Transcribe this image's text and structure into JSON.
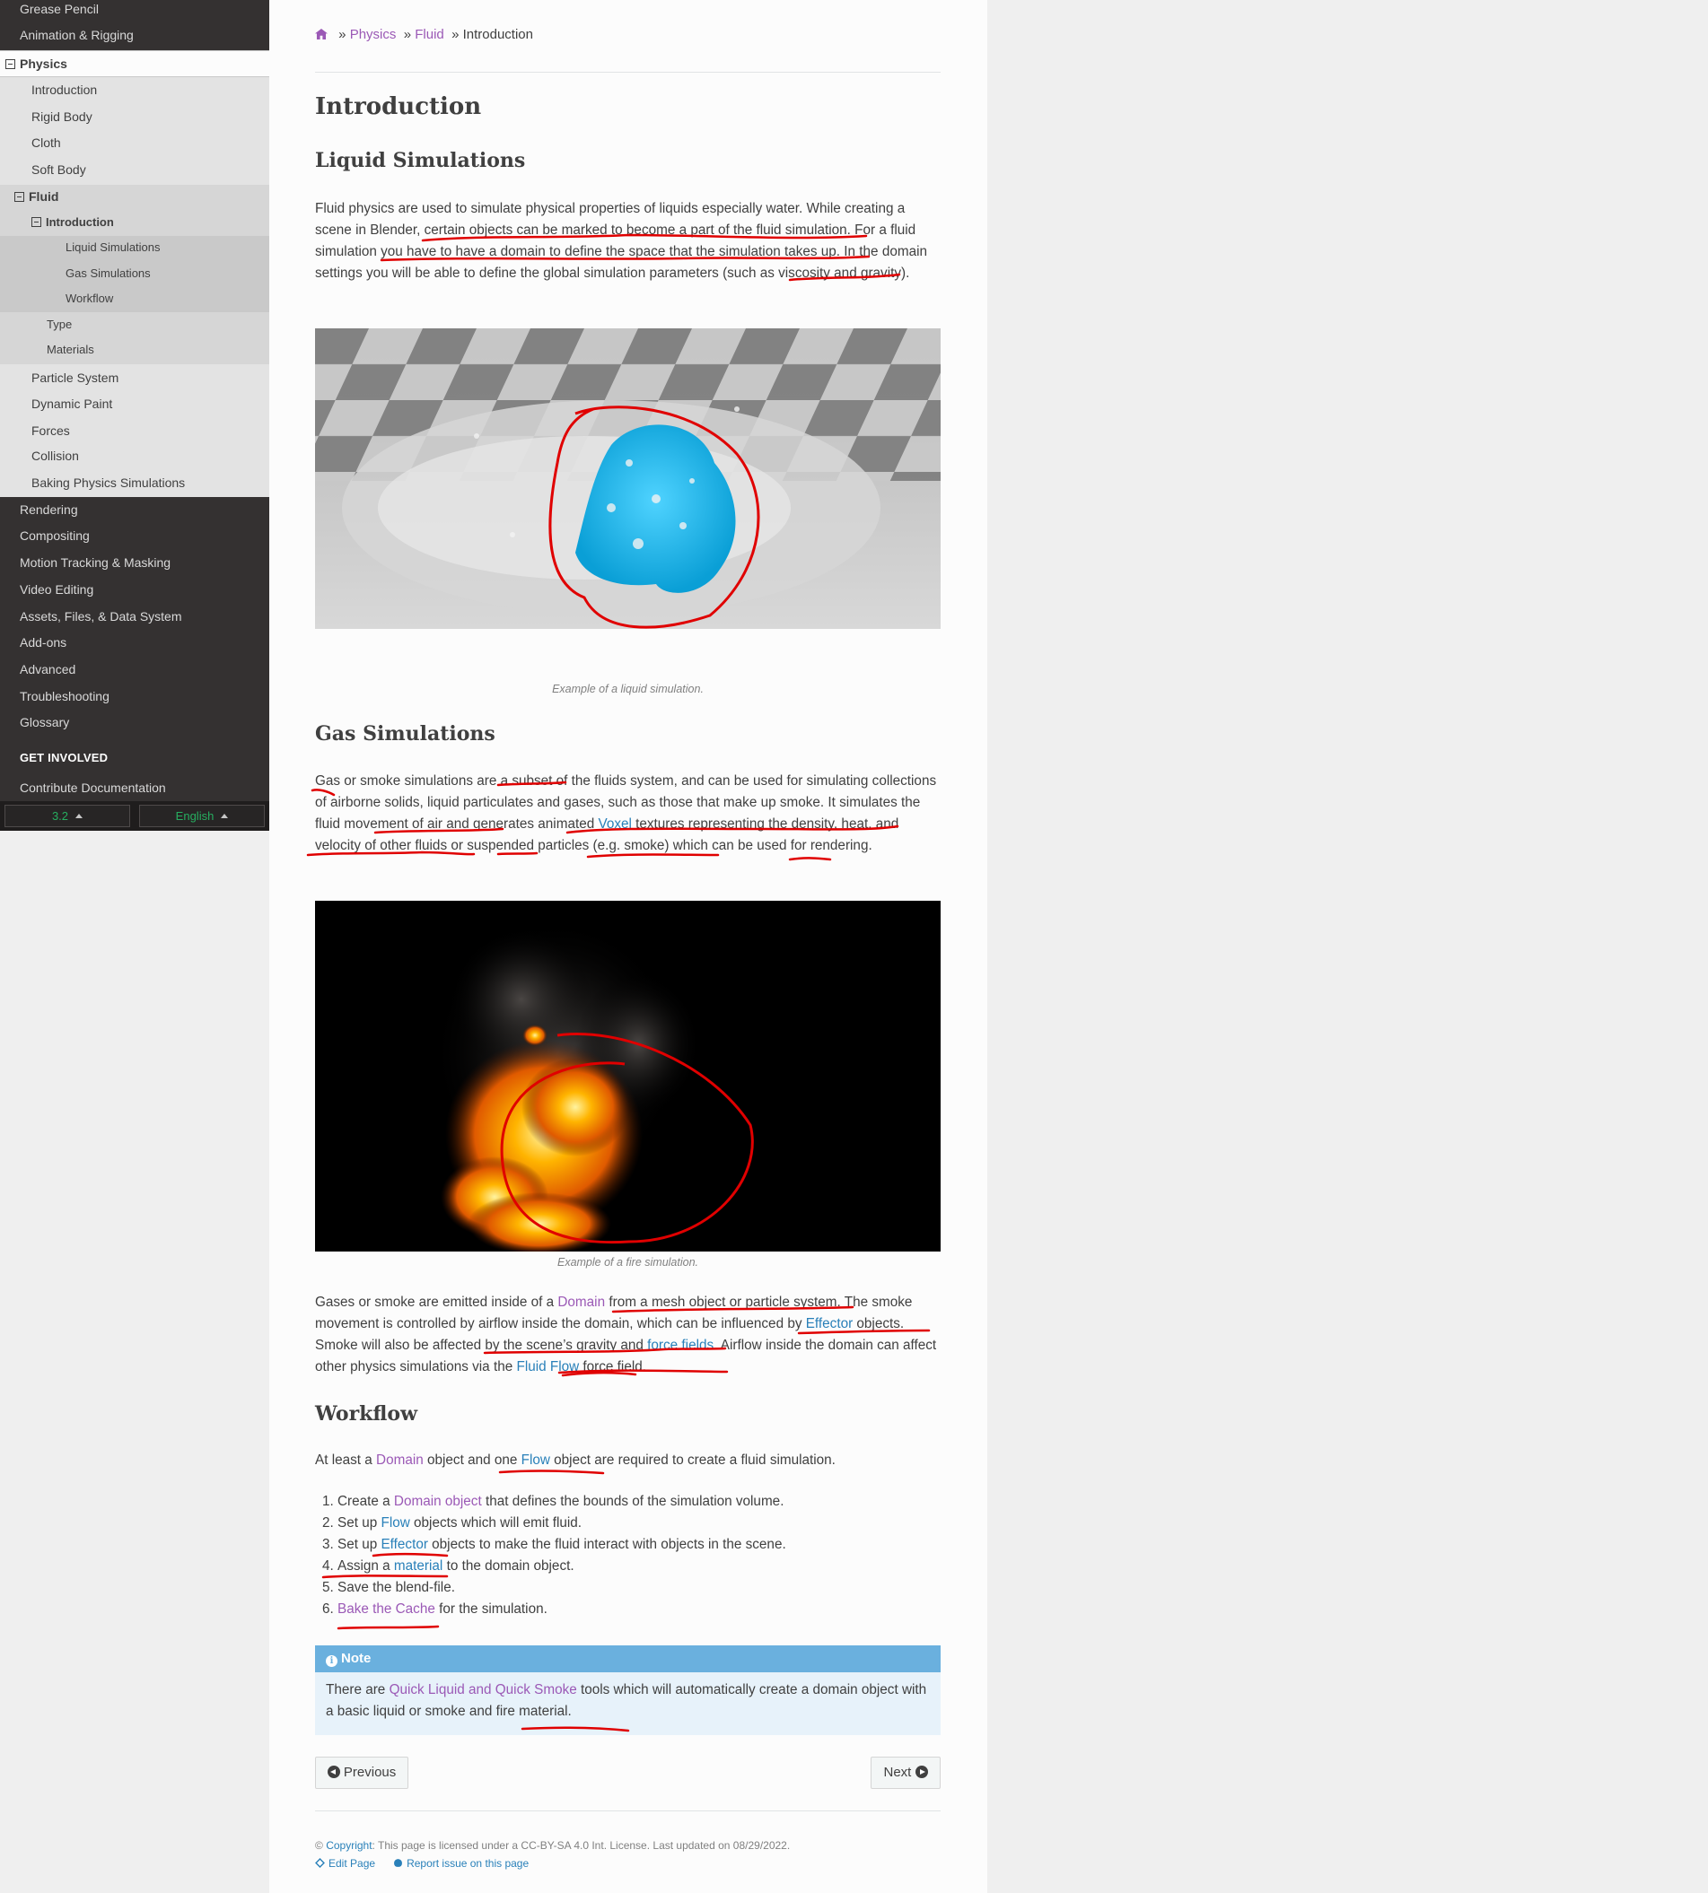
{
  "sidebar": {
    "top_items": [
      "Grease Pencil",
      "Animation & Rigging"
    ],
    "physics_label": "Physics",
    "physics_children": [
      "Introduction",
      "Rigid Body",
      "Cloth",
      "Soft Body"
    ],
    "fluid_label": "Fluid",
    "intro_label": "Introduction",
    "intro_children": [
      "Liquid Simulations",
      "Gas Simulations",
      "Workflow"
    ],
    "fluid_children": [
      "Type",
      "Materials"
    ],
    "physics_more": [
      "Particle System",
      "Dynamic Paint",
      "Forces",
      "Collision",
      "Baking Physics Simulations"
    ],
    "other_sections": [
      "Rendering",
      "Compositing",
      "Motion Tracking & Masking",
      "Video Editing",
      "Assets, Files, & Data System",
      "Add-ons",
      "Advanced",
      "Troubleshooting",
      "Glossary"
    ],
    "caption": "GET INVOLVED",
    "contribute": "Contribute Documentation",
    "version": "3.2",
    "language": "English",
    "colors": {
      "version": "#27ae60",
      "language": "#27ae60",
      "background": "#343131"
    }
  },
  "breadcrumb": {
    "physics": "Physics",
    "fluid": "Fluid",
    "current": "Introduction",
    "sep": "»"
  },
  "title": "Introduction",
  "liquid": {
    "heading": "Liquid Simulations",
    "para": "Fluid physics are used to simulate physical properties of liquids especially water. While creating a scene in Blender, certain objects can be marked to become a part of the fluid simulation. For a fluid simulation you have to have a domain to define the space that the simulation takes up. In the domain settings you will be able to define the global simulation parameters (such as viscosity and gravity).",
    "caption": "Example of a liquid simulation."
  },
  "gas": {
    "heading": "Gas Simulations",
    "para_pre": "Gas or smoke simulations are a subset of the fluids system, and can be used for simulating collections of airborne solids, liquid particulates and gases, such as those that make up smoke. It simulates the fluid movement of air and generates animated ",
    "voxel": "Voxel",
    "para_post": " textures representing the density, heat, and velocity of other fluids or suspended particles (e.g. smoke) which can be used for rendering.",
    "caption": "Example of a fire simulation.",
    "p2_a": "Gases or smoke are emitted inside of a ",
    "p2_domain": "Domain",
    "p2_b": " from a mesh object or particle system. The smoke movement is controlled by airflow inside the domain, which can be influenced by ",
    "p2_effector": "Effector",
    "p2_c": " objects. Smoke will also be affected by the scene’s gravity and ",
    "p2_forcefields": "force fields",
    "p2_d": ". Airflow inside the domain can affect other physics simulations via the ",
    "p2_fluidflow": "Fluid Flow",
    "p2_e": " force field."
  },
  "workflow": {
    "heading": "Workflow",
    "intro_a": "At least a ",
    "intro_domain": "Domain",
    "intro_b": " object and one ",
    "intro_flow": "Flow",
    "intro_c": " object are required to create a fluid simulation.",
    "steps": [
      {
        "pre": "Create a ",
        "link": "Domain object",
        "post": " that defines the bounds of the simulation volume."
      },
      {
        "pre": "Set up ",
        "link": "Flow",
        "post": " objects which will emit fluid."
      },
      {
        "pre": "Set up ",
        "link": "Effector",
        "post": " objects to make the fluid interact with objects in the scene."
      },
      {
        "pre": "Assign a ",
        "link": "material",
        "post": " to the domain object."
      },
      {
        "pre": "Save the blend-file.",
        "link": "",
        "post": ""
      },
      {
        "pre": "",
        "link": "Bake the Cache",
        "post": " for the simulation."
      }
    ]
  },
  "note": {
    "title": "Note",
    "text_a": "There are ",
    "link": "Quick Liquid and Quick Smoke",
    "text_b": " tools which will automatically create a domain object with a basic liquid or smoke and fire material."
  },
  "nav": {
    "previous": "Previous",
    "next": "Next"
  },
  "footer": {
    "copyright_sym": "©",
    "copyright_link": "Copyright",
    "license": ": This page is licensed under a CC-BY-SA 4.0 Int. License. Last updated on 08/29/2022.",
    "edit": "Edit Page",
    "report": "Report issue on this page"
  }
}
